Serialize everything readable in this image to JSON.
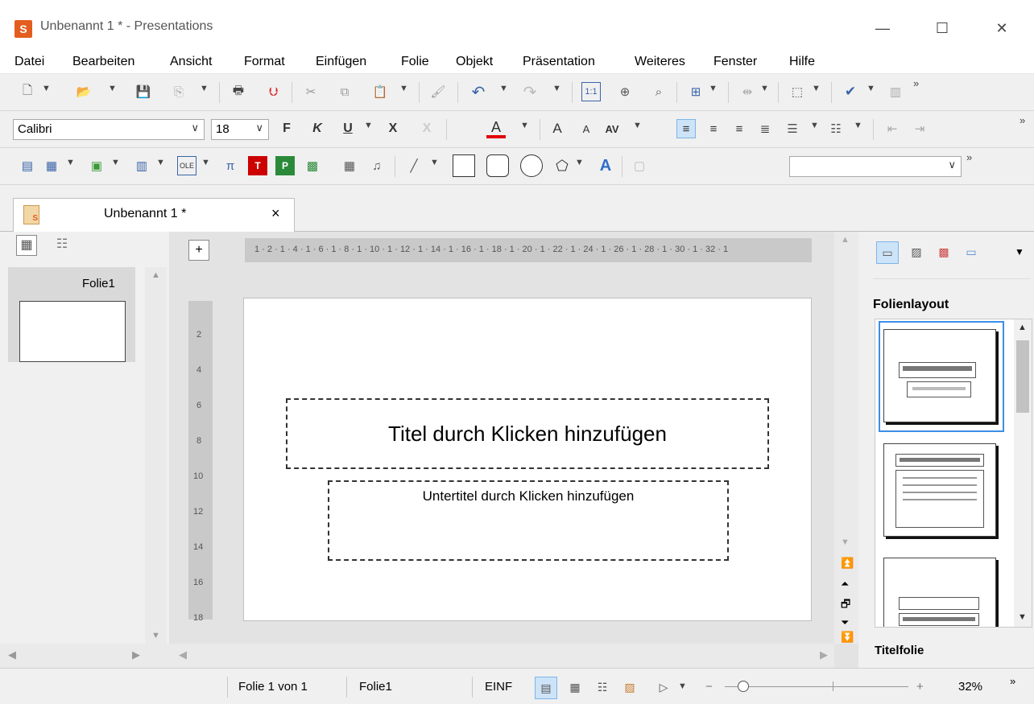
{
  "window": {
    "app_icon": "S",
    "title": "Unbenannt 1 * - Presentations",
    "minimize_glyph": "—",
    "maximize_glyph": "☐",
    "close_glyph": "✕"
  },
  "menu": [
    "Datei",
    "Bearbeiten",
    "Ansicht",
    "Format",
    "Einfügen",
    "Folie",
    "Objekt",
    "Präsentation",
    "Weiteres",
    "Fenster",
    "Hilfe"
  ],
  "toolbar2": {
    "font": "Calibri",
    "size": "18",
    "bold": "F",
    "italic": "K",
    "underline": "U",
    "strike": "X",
    "color": "A",
    "grow": "A",
    "shrink": "A",
    "spacing": "AV"
  },
  "icons": {
    "new": "new-document-icon",
    "open": "open-folder-icon",
    "save": "save-icon",
    "print": "print-icon",
    "pdf": "pdf-icon",
    "cut": "cut-icon",
    "copy": "copy-icon",
    "paste": "paste-icon",
    "undo": "undo-icon",
    "redo": "redo-icon"
  },
  "tab": {
    "label": "Unbenannt 1 *",
    "close": "×"
  },
  "sidebar": {
    "slide_label": "Folie1"
  },
  "ruler": {
    "h_labels": "1 · 2 · 1 · 4 · 1 · 6 · 1 · 8 · 1 · 10 · 1 · 12 · 1 · 14 · 1 · 16 · 1 · 18 · 1 · 20 · 1 · 22 · 1 · 24 · 1 · 26 · 1 · 28 · 1 · 30 · 1 · 32 · 1",
    "v_labels": [
      "2",
      "4",
      "6",
      "8",
      "10",
      "12",
      "14",
      "16",
      "18"
    ]
  },
  "slide": {
    "title_placeholder": "Titel durch Klicken hinzufügen",
    "subtitle_placeholder": "Untertitel durch Klicken hinzufügen"
  },
  "right_panel": {
    "heading": "Folienlayout",
    "selected_layout": "Titelfolie"
  },
  "status": {
    "slide_pos": "Folie 1 von 1",
    "slide_name": "Folie1",
    "mode": "EINF",
    "zoom": "32%",
    "zoom_fraction": 0.32,
    "minus": "−",
    "plus": "+"
  },
  "colors": {
    "accent": "#3d8ee6",
    "app_icon": "#e35d1e",
    "font_color_bar": "#e00000"
  }
}
